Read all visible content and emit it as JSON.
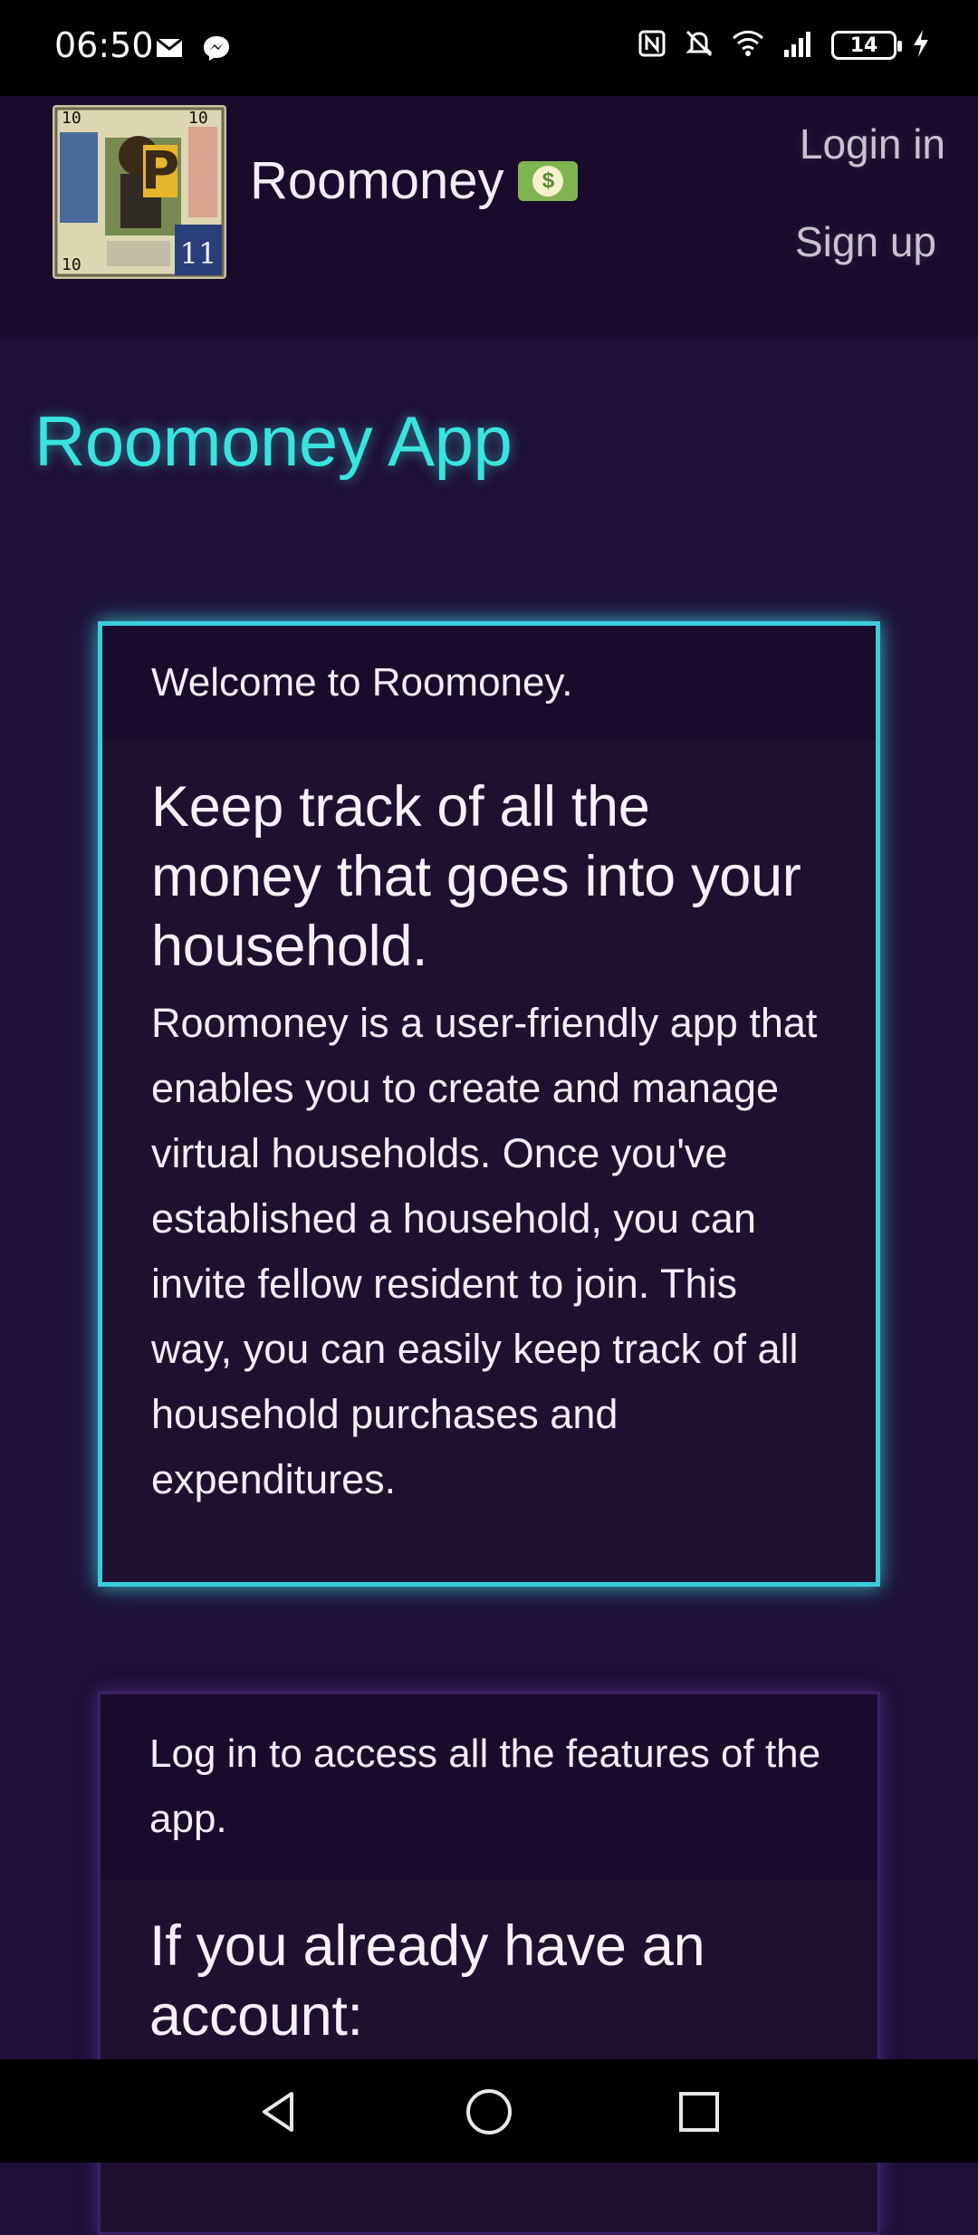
{
  "status_bar": {
    "time": "06:50",
    "battery": "14",
    "icons": [
      "gmail-icon",
      "messenger-icon",
      "nfc-icon",
      "mute-icon",
      "wifi-icon",
      "signal-icon",
      "battery-icon",
      "charging-icon"
    ]
  },
  "header": {
    "app_name": "Roomoney",
    "login_label": "Login in",
    "signup_label": "Sign up",
    "logo_numbers": {
      "top_left": "10",
      "top_right": "10",
      "bottom_left": "10",
      "bottom_right": "11",
      "center_letter": "P"
    },
    "money_icon_symbol": "$"
  },
  "page": {
    "title": "Roomoney App"
  },
  "welcome_card": {
    "header_text": "Welcome to Roomoney.",
    "heading": "Keep track of all the money that goes into your household.",
    "body": "Roomoney is a user-friendly app that enables you to create and manage virtual households. Once you've established a household, you can invite fellow resident to join. This way, you can easily keep track of all household purchases and expenditures."
  },
  "login_card": {
    "header_text": "Log in to access all the features of the app.",
    "heading": "If you already have an account:"
  },
  "colors": {
    "background": "#1f1037",
    "header_background": "#1a0b2c",
    "title_accent": "#39e4dd",
    "welcome_card_border": "#38cedb",
    "login_card_border": "#3a1f68"
  }
}
